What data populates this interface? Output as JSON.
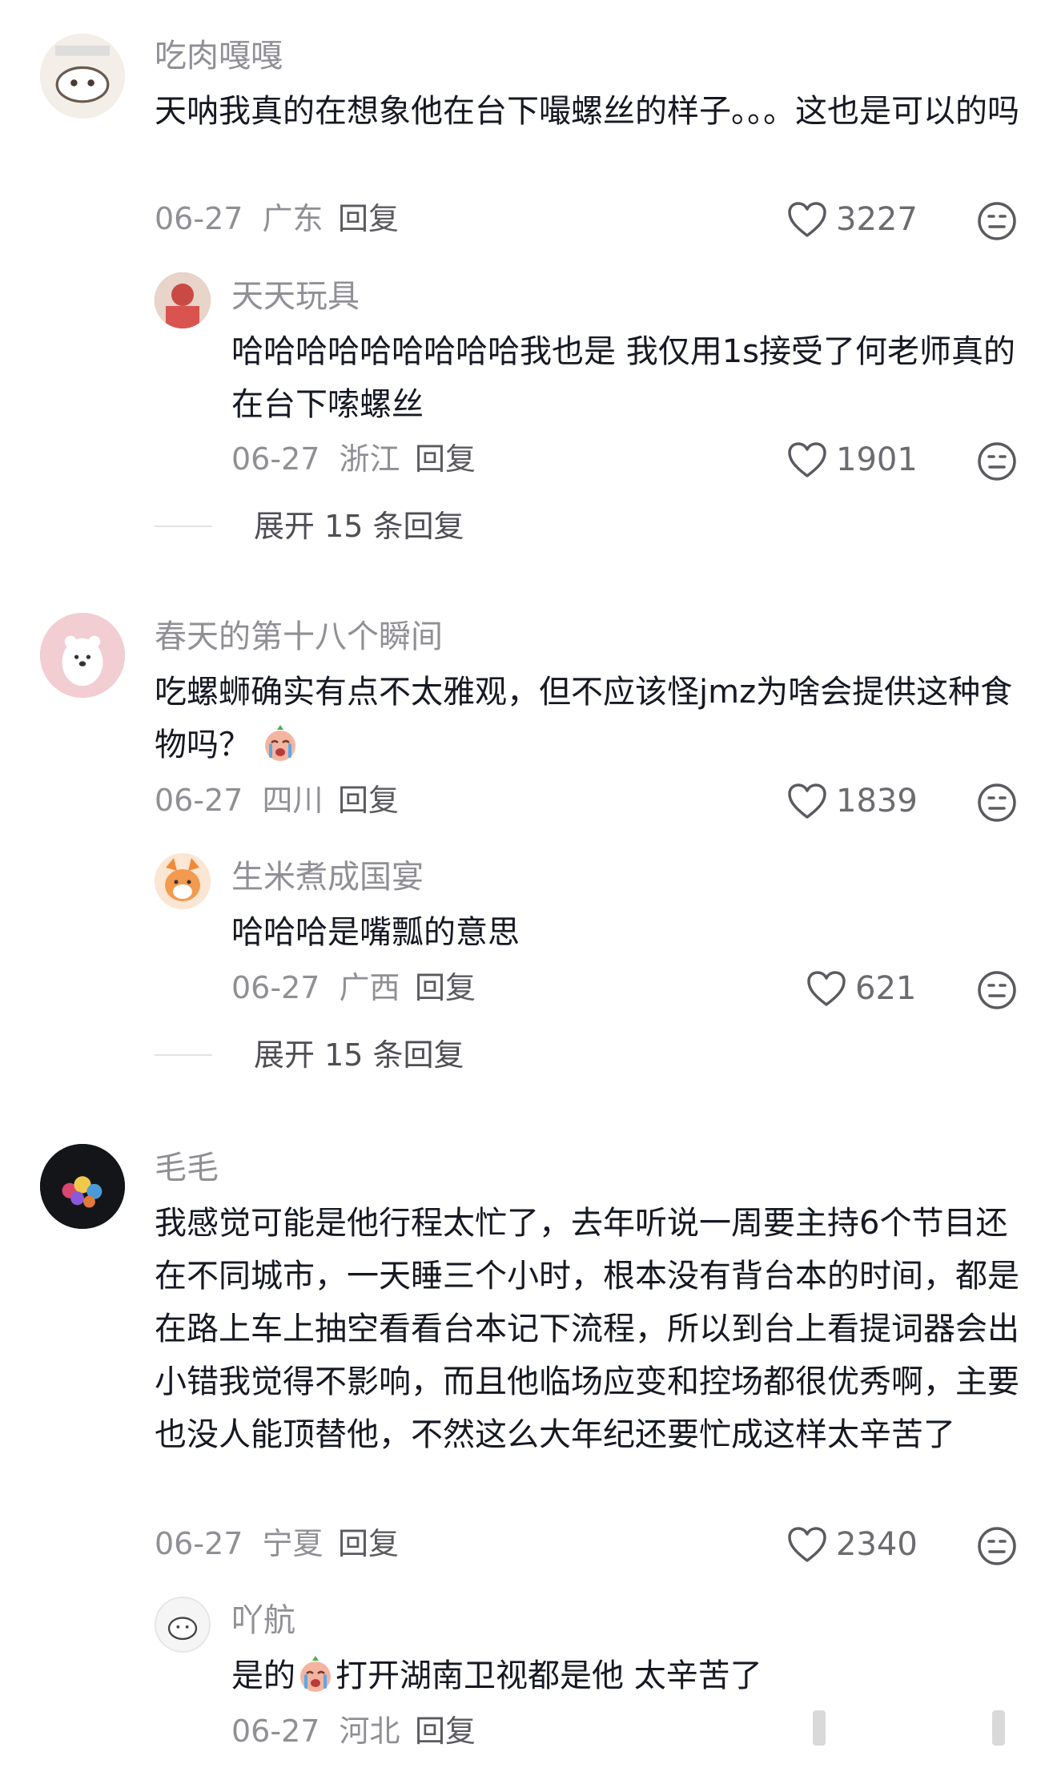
{
  "comments": [
    {
      "user": "吃肉嘎嘎",
      "text": "天呐我真的在想象他在台下嘬螺丝的样子。。。这也是可以的吗",
      "date": "06-27",
      "location": "广东",
      "reply_label": "回复",
      "likes": "3227",
      "replies": [
        {
          "user": "天天玩具",
          "text": "哈哈哈哈哈哈哈哈哈我也是 我仅用1s接受了何老师真的在台下嗦螺丝",
          "date": "06-27",
          "location": "浙江",
          "reply_label": "回复",
          "likes": "1901"
        }
      ],
      "expand_label": "展开 15 条回复"
    },
    {
      "user": "春天的第十八个瞬间",
      "text": "吃螺蛳确实有点不太雅观，但不应该怪jmz为啥会提供这种食物吗？",
      "emoji": "crying-face",
      "date": "06-27",
      "location": "四川",
      "reply_label": "回复",
      "likes": "1839",
      "replies": [
        {
          "user": "生米煮成国宴",
          "text": "哈哈哈是嘴瓢的意思",
          "date": "06-27",
          "location": "广西",
          "reply_label": "回复",
          "likes": "621"
        }
      ],
      "expand_label": "展开 15 条回复"
    },
    {
      "user": "毛毛",
      "text": "我感觉可能是他行程太忙了，去年听说一周要主持6个节目还在不同城市，一天睡三个小时，根本没有背台本的时间，都是在路上车上抽空看看台本记下流程，所以到台上看提词器会出小错我觉得不影响，而且他临场应变和控场都很优秀啊，主要也没人能顶替他，不然这么大年纪还要忙成这样太辛苦了",
      "date": "06-27",
      "location": "宁夏",
      "reply_label": "回复",
      "likes": "2340",
      "replies": [
        {
          "user": "吖航",
          "text_before": "是的",
          "emoji": "crying-face",
          "text_after": "打开湖南卫视都是他 太辛苦了",
          "date": "06-27",
          "location": "河北",
          "reply_label": "回复"
        }
      ]
    }
  ],
  "icons": {
    "like": "heart-outline-icon",
    "dislike": "meh-face-icon",
    "emoji": "crying-face-emoji"
  },
  "colors": {
    "username": "#8f8f95",
    "body_text": "#161823",
    "meta_text": "#8f8f95"
  }
}
